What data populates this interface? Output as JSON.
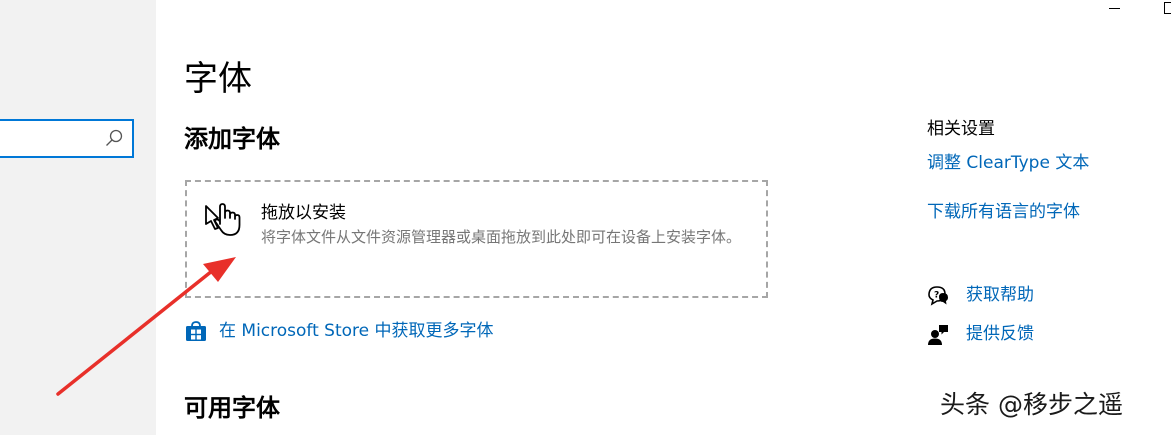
{
  "page": {
    "title": "字体",
    "add_section": "添加字体",
    "available_section": "可用字体"
  },
  "drop_zone": {
    "title": "拖放以安装",
    "description": "将字体文件从文件资源管理器或桌面拖放到此处即可在设备上安装字体。"
  },
  "store_link": {
    "label": "在 Microsoft Store 中获取更多字体",
    "icon": "store-bag-icon"
  },
  "related": {
    "heading": "相关设置",
    "links": [
      "调整 ClearType 文本",
      "下载所有语言的字体"
    ]
  },
  "help": {
    "get_help": "获取帮助",
    "feedback": "提供反馈"
  },
  "watermark": "头条 @移步之遥",
  "colors": {
    "accent": "#0078d7",
    "link": "#0067b8",
    "sidebar_bg": "#f2f2f2",
    "arrow": "#e8302a",
    "muted_text": "#767676"
  }
}
